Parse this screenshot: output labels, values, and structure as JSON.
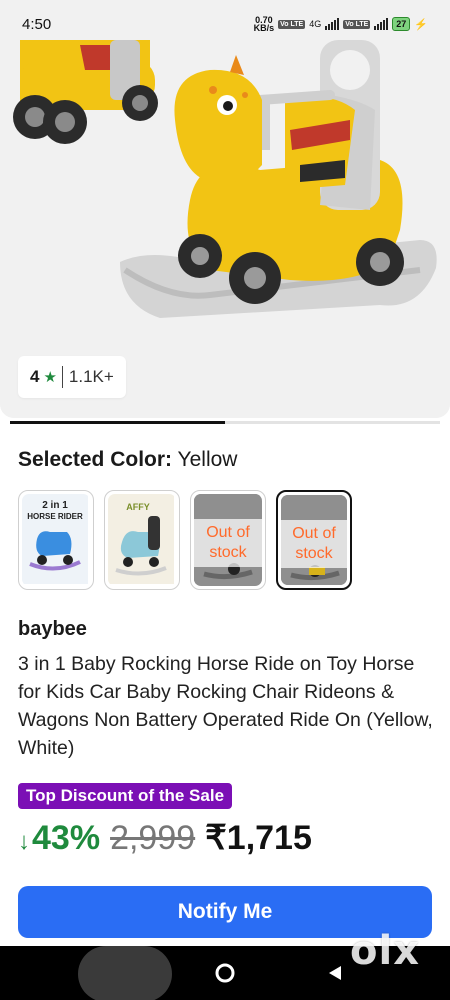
{
  "status_bar": {
    "time": "4:50",
    "net_speed_value": "0.70",
    "net_speed_unit": "KB/s",
    "lte1": "Vo LTE",
    "network": "4G",
    "lte2": "Vo LTE",
    "battery": "27"
  },
  "product": {
    "rating": "4",
    "rating_count": "1.1K+",
    "selected_color_label": "Selected Color:",
    "selected_color_value": "Yellow",
    "variants": [
      {
        "label": "2 in 1 HORSE RIDER",
        "state": "available"
      },
      {
        "label": "AFFY",
        "state": "available"
      },
      {
        "label": "Out of stock",
        "state": "out_of_stock"
      },
      {
        "label": "Out of stock",
        "state": "out_of_stock"
      }
    ],
    "brand": "baybee",
    "title": "3 in 1 Baby Rocking Horse Ride on Toy Horse for Kids Car Baby Rocking Chair Rideons & Wagons Non Battery Operated Ride On (Yellow, White)",
    "discount_badge": "Top Discount of the Sale",
    "discount_percent": "43%",
    "mrp": "2,999",
    "price": "₹1,715",
    "notify_button": "Notify Me"
  },
  "watermark": "olx",
  "colors": {
    "accent_button": "#2a6df4",
    "discount_green": "#1f8a3d",
    "badge_purple": "#7b0fb5",
    "out_of_stock_text": "#ff6a2b"
  },
  "icons": {
    "rating": "star-icon",
    "discount": "arrow-down-icon",
    "nav_recent": "square-icon",
    "nav_home": "circle-icon",
    "nav_back": "triangle-back-icon"
  }
}
